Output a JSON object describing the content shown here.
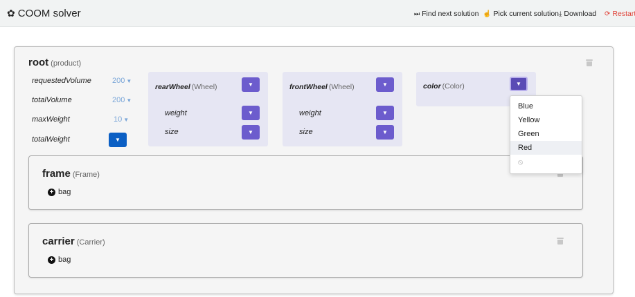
{
  "app": {
    "title": "COOM solver"
  },
  "toolbar": {
    "find_next": "Find next solution",
    "pick_current": "Pick current solution",
    "download": "Download",
    "restart": "Restart"
  },
  "root": {
    "name": "root",
    "type": "(product)",
    "attributes": [
      {
        "label": "requestedVolume",
        "value": "200"
      },
      {
        "label": "totalVolume",
        "value": "200"
      },
      {
        "label": "maxWeight",
        "value": "10"
      },
      {
        "label": "totalWeight"
      }
    ]
  },
  "rearWheel": {
    "name": "rearWheel",
    "type": "(Wheel)",
    "attr1": "weight",
    "attr2": "size"
  },
  "frontWheel": {
    "name": "frontWheel",
    "type": "(Wheel)",
    "attr1": "weight",
    "attr2": "size"
  },
  "color": {
    "name": "color",
    "type": "(Color)"
  },
  "color_menu": {
    "options": [
      "Blue",
      "Yellow",
      "Green",
      "Red"
    ],
    "highlighted": "Red",
    "none_symbol": "⦸"
  },
  "frame": {
    "name": "frame",
    "type": "(Frame)",
    "add_label": "bag"
  },
  "carrier": {
    "name": "carrier",
    "type": "(Carrier)",
    "add_label": "bag"
  },
  "colors": {
    "accent_purple": "#6c5ccd",
    "accent_blue": "#0b5fc4",
    "restart_red": "#e0443a",
    "value_blue": "#7aa6d8"
  },
  "icons": {
    "brand": "gear-icon",
    "find_next": "skip-next-icon",
    "pick": "hand-pointer-icon",
    "download": "download-icon",
    "restart": "refresh-icon",
    "delete": "trash-icon",
    "add": "plus-circle-icon"
  }
}
